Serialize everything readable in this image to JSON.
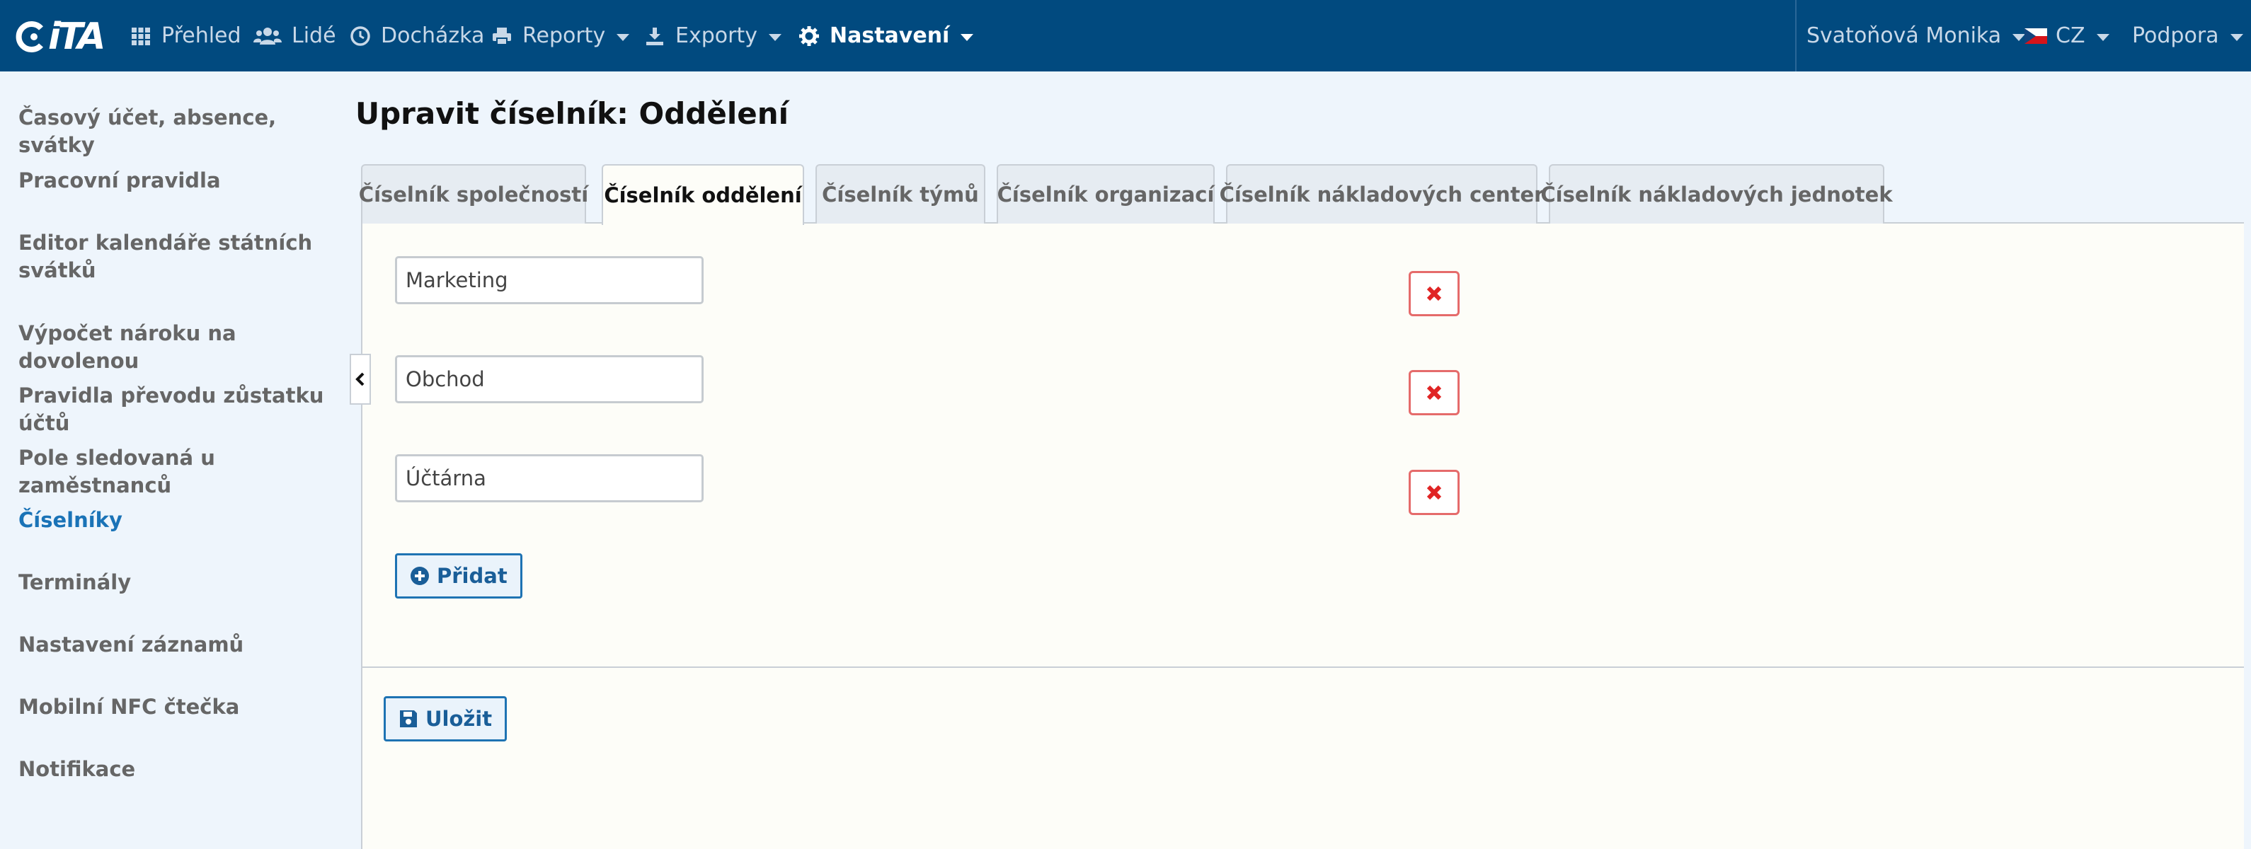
{
  "app": {
    "logo_text": "iTA"
  },
  "nav": {
    "items": [
      {
        "label": "Přehled",
        "icon": "grid-icon"
      },
      {
        "label": "Lidé",
        "icon": "users-icon"
      },
      {
        "label": "Docházka",
        "icon": "clock-icon"
      },
      {
        "label": "Reporty",
        "icon": "printer-icon"
      },
      {
        "label": "Exporty",
        "icon": "export-icon"
      },
      {
        "label": "Nastavení",
        "icon": "gear-icon",
        "active": true
      }
    ],
    "user": "Svatoňová Monika",
    "language": "CZ",
    "support": "Podpora"
  },
  "sidebar": {
    "items": [
      {
        "label": "Časový účet, absence, svátky"
      },
      {
        "label": "Pracovní pravidla"
      },
      {
        "label": "Editor kalendáře státních svátků"
      },
      {
        "label": "Výpočet nároku na dovolenou"
      },
      {
        "label": "Pravidla převodu zůstatku účtů"
      },
      {
        "label": "Pole sledovaná u zaměstnanců"
      },
      {
        "label": "Číselníky",
        "active": true
      },
      {
        "label": "Terminály"
      },
      {
        "label": "Nastavení záznamů"
      },
      {
        "label": "Mobilní NFC čtečka"
      },
      {
        "label": "Notifikace"
      }
    ]
  },
  "page": {
    "title": "Upravit číselník: Oddělení",
    "tabs": [
      {
        "label": "Číselník společností"
      },
      {
        "label": "Číselník oddělení",
        "active": true
      },
      {
        "label": "Číselník týmů"
      },
      {
        "label": "Číselník organizací"
      },
      {
        "label": "Číselník nákladových center"
      },
      {
        "label": "Číselník nákladových jednotek"
      }
    ],
    "entries": [
      {
        "value": "Marketing"
      },
      {
        "value": "Obchod"
      },
      {
        "value": "Účtárna"
      }
    ],
    "add_label": "Přidat",
    "save_label": "Uložit"
  },
  "colors": {
    "topbar": "#014a7f",
    "accent": "#1a73b7",
    "delete": "#e02424"
  }
}
